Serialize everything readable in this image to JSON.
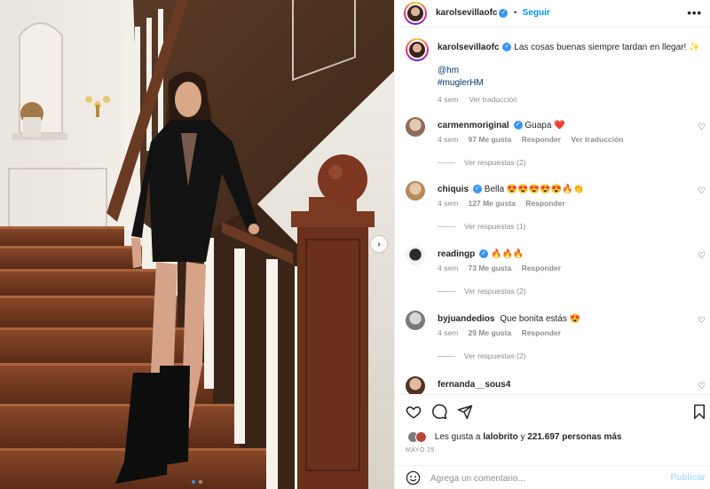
{
  "post": {
    "username": "karolsevillaofc",
    "verified": true,
    "follow_label": "Seguir",
    "more_label": "•••",
    "caption_text": "Las cosas buenas siempre tardan en llegar! ✨",
    "mention": "@hm",
    "hashtag": "#muglerHM",
    "time": "4 sem",
    "translate_label": "Ver traducción"
  },
  "comments": [
    {
      "username": "carmenmoriginal",
      "verified": true,
      "text": "Guapa ❤️",
      "time": "4 sem",
      "likes": "97 Me gusta",
      "reply_label": "Responder",
      "translate_label": "Ver traducción",
      "replies_label": "Ver respuestas (2)",
      "avatar_color": "#c9a48f"
    },
    {
      "username": "chiquis",
      "verified": true,
      "text": "Bella 😍😍😍😍😍🔥👏",
      "time": "4 sem",
      "likes": "127 Me gusta",
      "reply_label": "Responder",
      "replies_label": "Ver respuestas (1)",
      "avatar_color": "#d8b48e"
    },
    {
      "username": "readingp",
      "verified": true,
      "text": "🔥🔥🔥",
      "time": "4 sem",
      "likes": "73 Me gusta",
      "reply_label": "Responder",
      "replies_label": "Ver respuestas (2)",
      "avatar_color": "#2b2b2b"
    },
    {
      "username": "byjuandedios",
      "verified": false,
      "text": "Que bonita estás 😍",
      "time": "4 sem",
      "likes": "29 Me gusta",
      "reply_label": "Responder",
      "replies_label": "Ver respuestas (2)",
      "avatar_color": "#9a9a9a"
    },
    {
      "username": "fernanda__sous4",
      "verified": false,
      "text": "",
      "avatar_color": "#6e4a3a"
    }
  ],
  "likes_line": {
    "prefix": "Les gusta a",
    "user": "lalobrito",
    "middle": "y",
    "count": "221.697 personas más"
  },
  "date": "MAYO 25",
  "add_comment": {
    "placeholder": "Agrega un comentario...",
    "publish_label": "Publicar"
  },
  "carousel": {
    "slide_count": 2,
    "active_index": 0
  },
  "colors": {
    "accent": "#0095f6",
    "verified": "#3897f0",
    "muted": "#8e8e8e",
    "heart": "#ed4956"
  }
}
